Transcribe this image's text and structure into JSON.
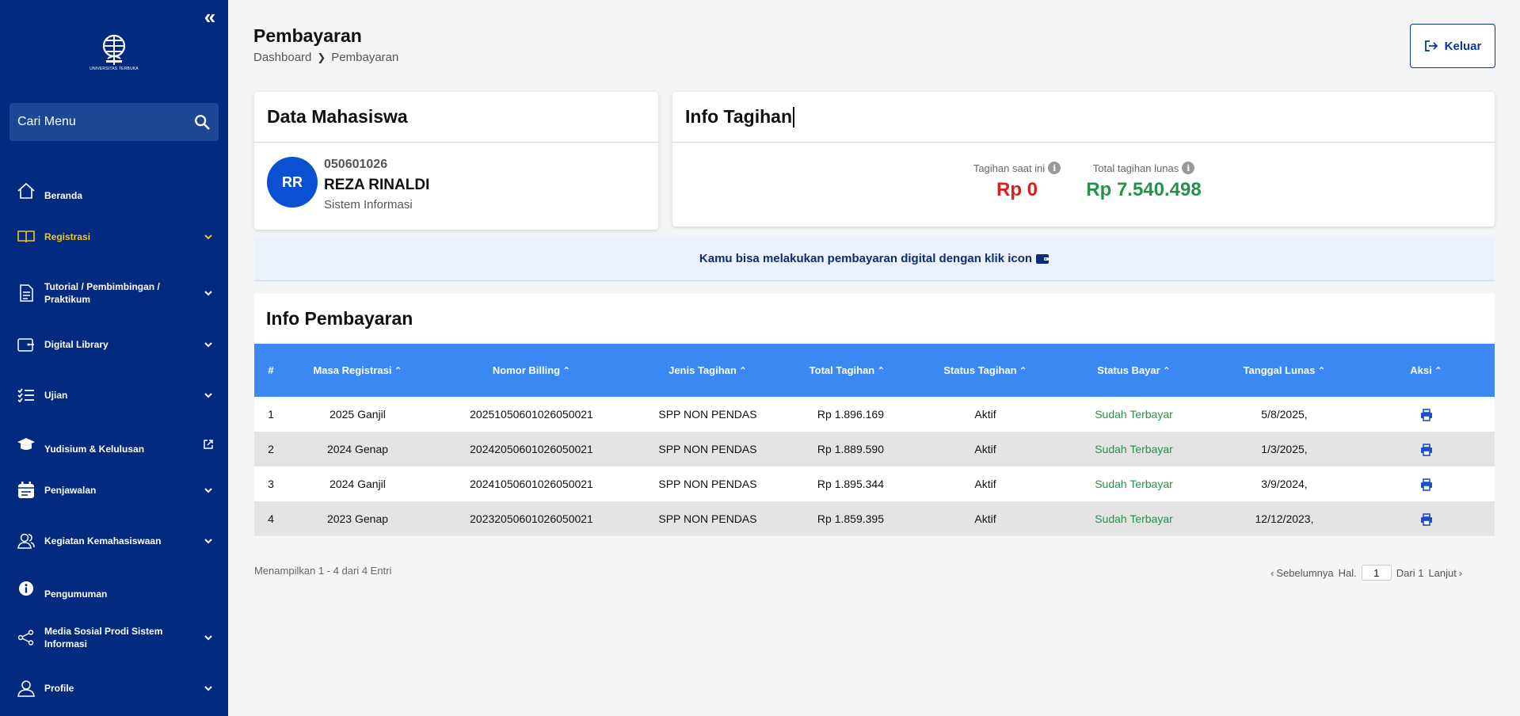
{
  "sidebar": {
    "logo_text": "UNIVERSITAS TERBUKA",
    "search_placeholder": "Cari Menu",
    "items": [
      {
        "label": "Beranda"
      },
      {
        "label": "Registrasi"
      },
      {
        "label": "Tutorial / Pembimbingan / Praktikum"
      },
      {
        "label": "Digital Library"
      },
      {
        "label": "Ujian"
      },
      {
        "label": "Yudisium & Kelulusan"
      },
      {
        "label": "Penjawalan"
      },
      {
        "label": "Kegiatan Kemahasiswaan"
      },
      {
        "label": "Pengumuman"
      },
      {
        "label": "Media Sosial Prodi Sistem Informasi"
      },
      {
        "label": "Profile"
      }
    ],
    "active_item": "Registrasi"
  },
  "header": {
    "title": "Pembayaran",
    "breadcrumb": [
      "Dashboard",
      "Pembayaran"
    ],
    "logout_label": "Keluar"
  },
  "student": {
    "card_title": "Data Mahasiswa",
    "initials": "RR",
    "nim": "050601026",
    "name": "REZA RINALDI",
    "program": "Sistem Informasi"
  },
  "billing": {
    "card_title": "Info Tagihan",
    "current_label": "Tagihan saat ini",
    "current_value": "Rp 0",
    "paid_label": "Total tagihan lunas",
    "paid_value": "Rp 7.540.498"
  },
  "notice": "Kamu bisa melakukan pembayaran digital dengan klik icon",
  "payments": {
    "title": "Info Pembayaran",
    "columns": [
      "#",
      "Masa Registrasi",
      "Nomor Billing",
      "Jenis Tagihan",
      "Total Tagihan",
      "Status Tagihan",
      "Status Bayar",
      "Tanggal Lunas",
      "Aksi"
    ],
    "rows": [
      {
        "no": "1",
        "masa": "2025 Ganjil",
        "billing": "20251050601026050021",
        "jenis": "SPP NON PENDAS",
        "total": "Rp 1.896.169",
        "status_tagihan": "Aktif",
        "status_bayar": "Sudah Terbayar",
        "tanggal": "5/8/2025,"
      },
      {
        "no": "2",
        "masa": "2024 Genap",
        "billing": "20242050601026050021",
        "jenis": "SPP NON PENDAS",
        "total": "Rp 1.889.590",
        "status_tagihan": "Aktif",
        "status_bayar": "Sudah Terbayar",
        "tanggal": "1/3/2025,"
      },
      {
        "no": "3",
        "masa": "2024 Ganjil",
        "billing": "20241050601026050021",
        "jenis": "SPP NON PENDAS",
        "total": "Rp 1.895.344",
        "status_tagihan": "Aktif",
        "status_bayar": "Sudah Terbayar",
        "tanggal": "3/9/2024,"
      },
      {
        "no": "4",
        "masa": "2023 Genap",
        "billing": "20232050601026050021",
        "jenis": "SPP NON PENDAS",
        "total": "Rp 1.859.395",
        "status_tagihan": "Aktif",
        "status_bayar": "Sudah Terbayar",
        "tanggal": "12/12/2023,"
      }
    ],
    "entries_text": "Menampilkan 1 - 4 dari 4 Entri"
  },
  "pagination": {
    "prev": "Sebelumnya",
    "page_label": "Hal.",
    "current_page": "1",
    "of_label": "Dari 1",
    "next": "Lanjut"
  },
  "colors": {
    "sidebar_bg": "#032a7e",
    "active_menu": "#f6c324",
    "table_header": "#3c88f2",
    "current_bill": "#d4211c",
    "paid": "#25924b"
  }
}
